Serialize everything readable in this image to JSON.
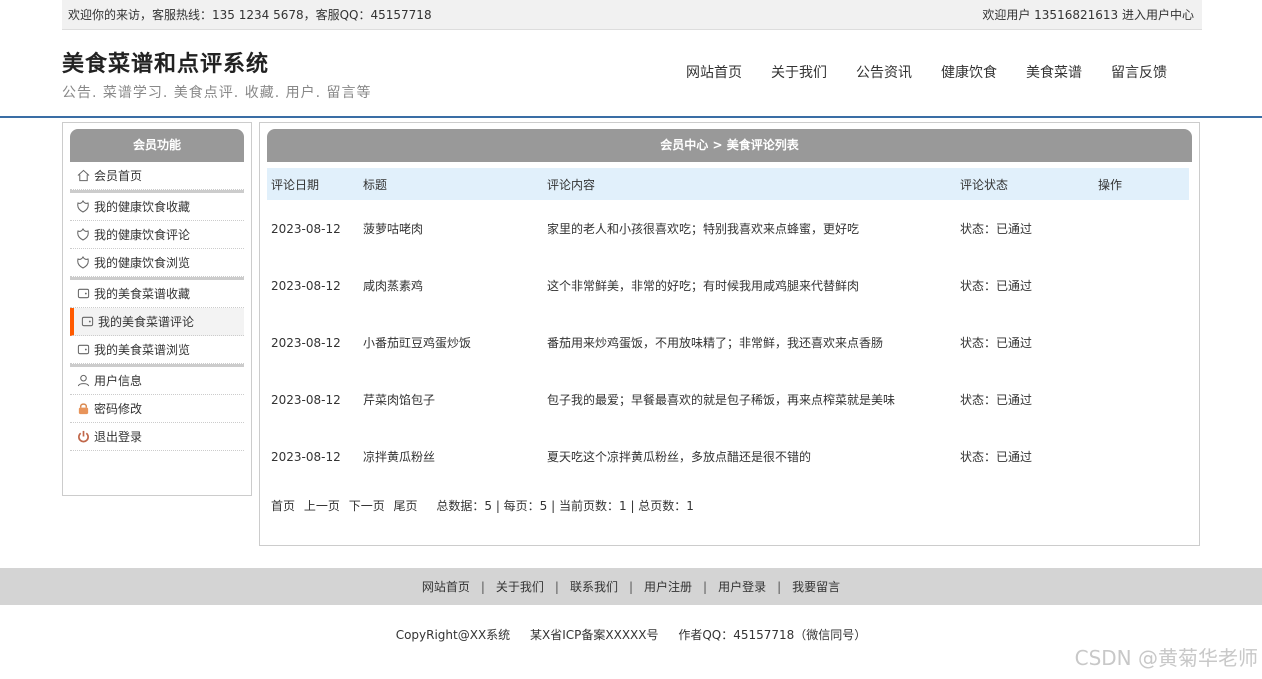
{
  "topbar": {
    "welcome": "欢迎你的来访，客服热线：135 1234 5678，客服QQ：45157718",
    "user": "欢迎用户 13516821613",
    "center_link": "进入用户中心"
  },
  "brand": {
    "title": "美食菜谱和点评系统",
    "subtitle": "公告. 菜谱学习. 美食点评. 收藏. 用户. 留言等"
  },
  "nav": [
    "网站首页",
    "关于我们",
    "公告资讯",
    "健康饮食",
    "美食菜谱",
    "留言反馈"
  ],
  "sidebar": {
    "header": "会员功能",
    "groups": [
      [
        {
          "label": "会员首页",
          "icon": "home-icon"
        }
      ],
      [
        {
          "label": "我的健康饮食收藏",
          "icon": "flower-icon"
        },
        {
          "label": "我的健康饮食评论",
          "icon": "flower-icon"
        },
        {
          "label": "我的健康饮食浏览",
          "icon": "flower-icon"
        }
      ],
      [
        {
          "label": "我的美食菜谱收藏",
          "icon": "wallet-icon"
        },
        {
          "label": "我的美食菜谱评论",
          "icon": "wallet-icon",
          "active": true
        },
        {
          "label": "我的美食菜谱浏览",
          "icon": "wallet-icon"
        }
      ],
      [
        {
          "label": "用户信息",
          "icon": "user-icon"
        },
        {
          "label": "密码修改",
          "icon": "lock-icon"
        },
        {
          "label": "退出登录",
          "icon": "power-icon"
        }
      ]
    ]
  },
  "main": {
    "header": "会员中心 > 美食评论列表",
    "columns": [
      "评论日期",
      "标题",
      "评论内容",
      "评论状态",
      "操作"
    ],
    "rows": [
      {
        "date": "2023-08-12",
        "title": "菠萝咕咾肉",
        "content": "家里的老人和小孩很喜欢吃；特别我喜欢来点蜂蜜，更好吃",
        "status": "状态：已通过"
      },
      {
        "date": "2023-08-12",
        "title": "咸肉蒸素鸡",
        "content": "这个非常鲜美，非常的好吃；有时候我用咸鸡腿来代替鲜肉",
        "status": "状态：已通过"
      },
      {
        "date": "2023-08-12",
        "title": "小番茄豇豆鸡蛋炒饭",
        "content": "番茄用来炒鸡蛋饭，不用放味精了；非常鲜，我还喜欢来点香肠",
        "status": "状态：已通过"
      },
      {
        "date": "2023-08-12",
        "title": "芹菜肉馅包子",
        "content": "包子我的最爱；早餐最喜欢的就是包子稀饭，再来点榨菜就是美味",
        "status": "状态：已通过"
      },
      {
        "date": "2023-08-12",
        "title": "凉拌黄瓜粉丝",
        "content": "夏天吃这个凉拌黄瓜粉丝，多放点醋还是很不错的",
        "status": "状态：已通过"
      }
    ],
    "pager": {
      "first": "首页",
      "prev": "上一页",
      "next": "下一页",
      "last": "尾页",
      "info": "总数据：5 | 每页：5 | 当前页数：1 | 总页数：1"
    }
  },
  "footer": {
    "links": [
      "网站首页",
      "关于我们",
      "联系我们",
      "用户注册",
      "用户登录",
      "我要留言"
    ],
    "separator": "|",
    "copyright": "CopyRight@XX系统",
    "icp": "某X省ICP备案XXXXX号",
    "author": "作者QQ：45157718（微信同号）"
  },
  "watermark": "CSDN @黄菊华老师",
  "colors": {
    "accent": "#ff5a00",
    "header_gray": "#999999",
    "table_head": "#e1f0fb",
    "rule_blue": "#3a6ea5"
  }
}
